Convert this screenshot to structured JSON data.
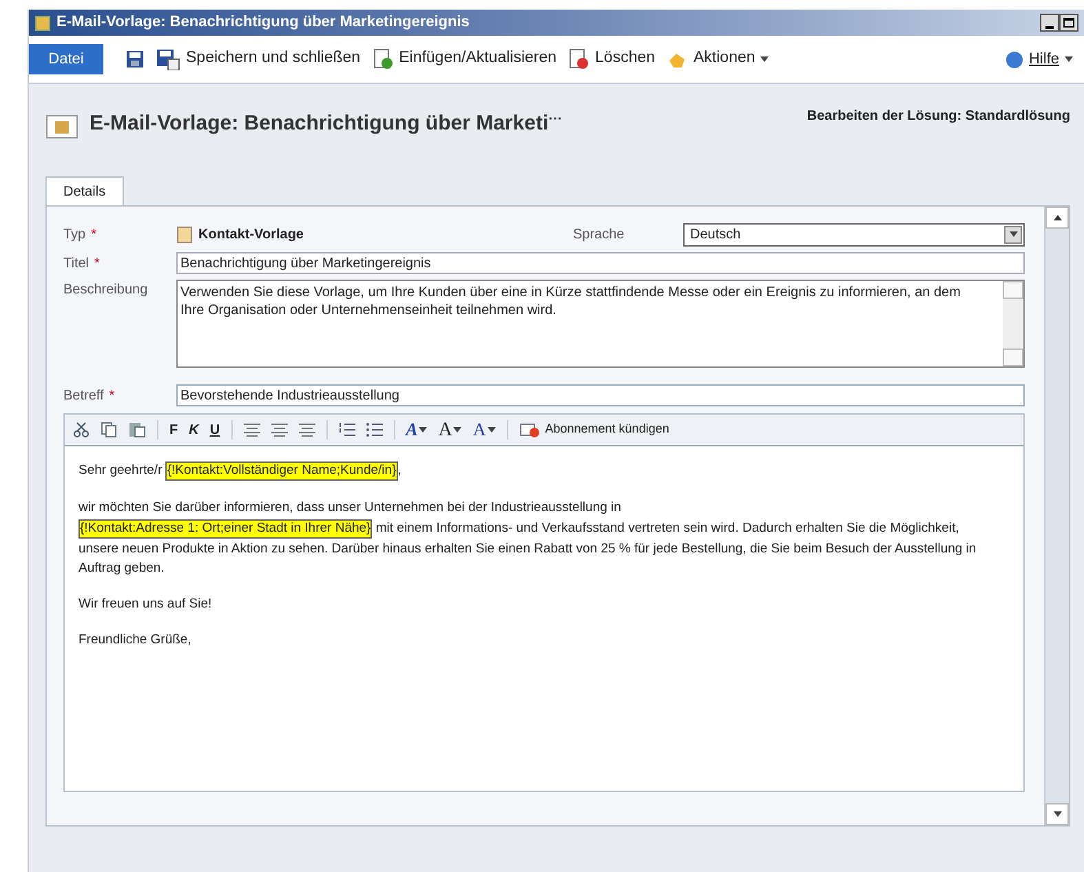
{
  "window": {
    "title": "E-Mail-Vorlage: Benachrichtigung über Marketingereignis"
  },
  "ribbon": {
    "file_tab": "Datei",
    "actions": [
      {
        "kind": "save"
      },
      {
        "kind": "save_close",
        "label": "Speichern und schließen"
      },
      {
        "kind": "insert",
        "label": "Einfügen/Aktualisieren"
      },
      {
        "kind": "delete",
        "label": "Löschen"
      },
      {
        "kind": "actions",
        "label": "Aktionen"
      }
    ],
    "help": "Hilfe"
  },
  "header": {
    "title": "E-Mail-Vorlage: Benachrichtigung über Marketi",
    "title_overflow": "⋯",
    "solution": "Bearbeiten der Lösung: Standardlösung"
  },
  "tabs": [
    {
      "label": "Details",
      "selected": true
    }
  ],
  "form": {
    "required_mark": "*",
    "type_label": "Typ",
    "type_required": true,
    "type_value": "Kontakt-Vorlage",
    "language_label": "Sprache",
    "language_value": "Deutsch",
    "title_label": "Titel",
    "title_required": true,
    "title_value": "Benachrichtigung über Marketingereignis",
    "description_label": "Beschreibung",
    "description_value": "Verwenden Sie diese Vorlage, um Ihre Kunden über eine in Kürze stattfindende Messe oder ein Ereignis zu informieren, an dem Ihre Organisation oder Unternehmenseinheit teilnehmen wird.",
    "subject_label": "Betreff",
    "subject_required": true,
    "subject_value": "Bevorstehende Industrieausstellung"
  },
  "editor": {
    "format_buttons": [
      "F",
      "K",
      "U"
    ],
    "font_buttons": [
      "A",
      "A",
      "A"
    ],
    "unsubscribe": "Abonnement kündigen",
    "paragraphs": [
      [
        {
          "kind": "text",
          "text": "Sehr geehrte/r "
        },
        {
          "kind": "field",
          "text": "{!Kontakt:Vollständiger Name;Kunde/in}"
        },
        {
          "kind": "text",
          "text": ","
        }
      ],
      [
        {
          "kind": "text",
          "text": "wir möchten Sie darüber informieren, dass unser Unternehmen bei der Industrieausstellung in"
        },
        {
          "kind": "break"
        },
        {
          "kind": "field",
          "text": "{!Kontakt:Adresse 1: Ort;einer Stadt in Ihrer Nähe}"
        },
        {
          "kind": "text",
          "text": " mit einem Informations- und Verkaufsstand vertreten sein wird. Dadurch erhalten Sie die Möglichkeit, unsere neuen Produkte in Aktion zu sehen. Darüber hinaus erhalten Sie einen Rabatt von 25 % für jede Bestellung, die Sie beim Besuch der Ausstellung in Auftrag geben."
        }
      ],
      [
        {
          "kind": "text",
          "text": "Wir freuen uns auf Sie!"
        }
      ],
      [
        {
          "kind": "text",
          "text": "Freundliche Grüße,"
        }
      ]
    ]
  }
}
